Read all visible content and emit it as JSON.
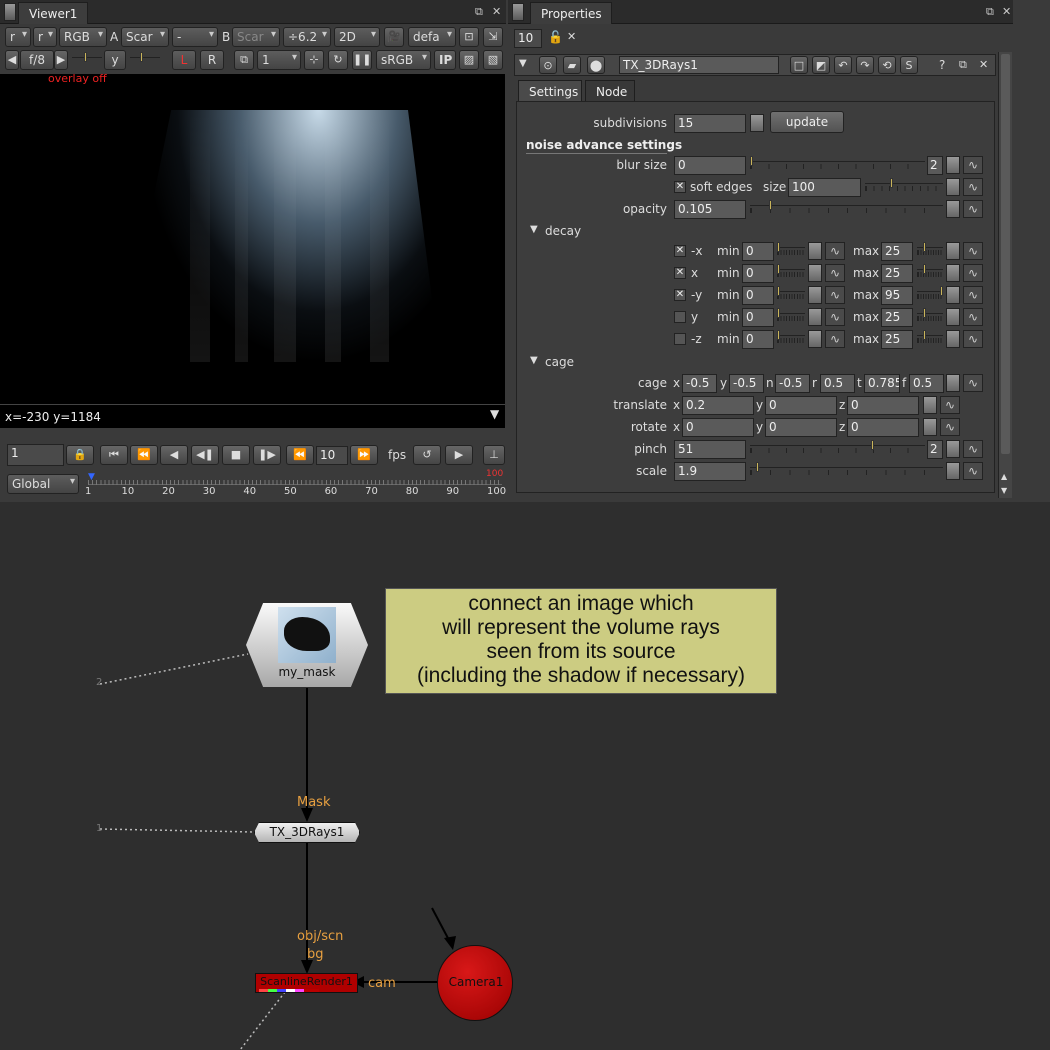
{
  "viewer": {
    "tab": "Viewer1",
    "toolbar1": {
      "ch1": "r",
      "ch2": "r",
      "channels": "RGB",
      "a_label": "A",
      "a_input": "Scar",
      "a_op": "-",
      "b_label": "B",
      "b_input": "Scar",
      "gain": "÷6.2",
      "mode": "2D",
      "lut": "defa"
    },
    "toolbar2": {
      "fstop": "f/8",
      "y_label": "y",
      "gamma_val": "1",
      "L": "L",
      "R": "R",
      "proxy": "1",
      "colorspace": "sRGB",
      "ip": "IP"
    },
    "overlay_text": "overlay off",
    "coords": "x=-230 y=1184",
    "timeline": {
      "frame": "1",
      "step": "10",
      "fps_label": "fps",
      "range_mode": "Global",
      "ticks": [
        "1",
        "10",
        "20",
        "30",
        "40",
        "50",
        "60",
        "70",
        "80",
        "90",
        "100"
      ],
      "end_marker": "100"
    }
  },
  "properties": {
    "tab": "Properties",
    "max_panels": "10",
    "node_name": "TX_3DRays1",
    "tabs": [
      "Settings",
      "Node"
    ],
    "subdivisions": {
      "label": "subdivisions",
      "value": "15",
      "button": "update"
    },
    "section_noise": "noise advance settings",
    "blur_size": {
      "label": "blur size",
      "value": "0",
      "extra": "2",
      "ticks": [
        "0",
        "10",
        "40",
        "70",
        "100"
      ]
    },
    "soft_edges": {
      "label": "soft edges",
      "checked": true,
      "size_label": "size",
      "size_value": "100",
      "ticks": [
        "0",
        "100",
        "200",
        "300"
      ]
    },
    "opacity": {
      "label": "opacity",
      "value": "0.105",
      "ticks": [
        "0",
        "0.2",
        "0.4",
        "0.6",
        "0.8",
        "1"
      ]
    },
    "decay": {
      "label": "decay",
      "min_label": "min",
      "max_label": "max",
      "mini_ticks": [
        "0",
        "100"
      ],
      "rows": [
        {
          "axis": "-x",
          "checked": true,
          "min": "0",
          "max": "25"
        },
        {
          "axis": "x",
          "checked": true,
          "min": "0",
          "max": "25"
        },
        {
          "axis": "-y",
          "checked": true,
          "min": "0",
          "max": "95"
        },
        {
          "axis": "y",
          "checked": false,
          "min": "0",
          "max": "25"
        },
        {
          "axis": "-z",
          "checked": false,
          "min": "0",
          "max": "25"
        }
      ]
    },
    "cage": {
      "label": "cage",
      "cage_row": {
        "label": "cage",
        "x": "-0.5",
        "y": "-0.5",
        "n": "-0.5",
        "r": "0.5",
        "t": "0.785",
        "f": "0.5"
      },
      "translate": {
        "label": "translate",
        "x": "0.2",
        "y": "0",
        "z": "0"
      },
      "rotate": {
        "label": "rotate",
        "x": "0",
        "y": "0",
        "z": "0"
      },
      "pinch": {
        "label": "pinch",
        "value": "51",
        "extra": "2",
        "ticks": [
          "0",
          "10",
          "40",
          "70",
          "100"
        ]
      },
      "scale": {
        "label": "scale",
        "value": "1.9",
        "ticks": [
          "0",
          "10",
          "20",
          "30",
          "40",
          "50"
        ]
      }
    }
  },
  "dag": {
    "note": [
      "connect an image which",
      "will represent the volume rays",
      "seen from its source",
      "(including the shadow if necessary)"
    ],
    "nodes": {
      "mask_node": "my_mask",
      "rays_node": "TX_3DRays1",
      "render_node": "ScanlineRender1",
      "camera_node": "Camera1"
    },
    "pipe_labels": {
      "mask": "Mask",
      "objscn": "obj/scn",
      "bg": "bg",
      "cam": "cam",
      "input_num": "2",
      "input_num2": "1"
    }
  }
}
